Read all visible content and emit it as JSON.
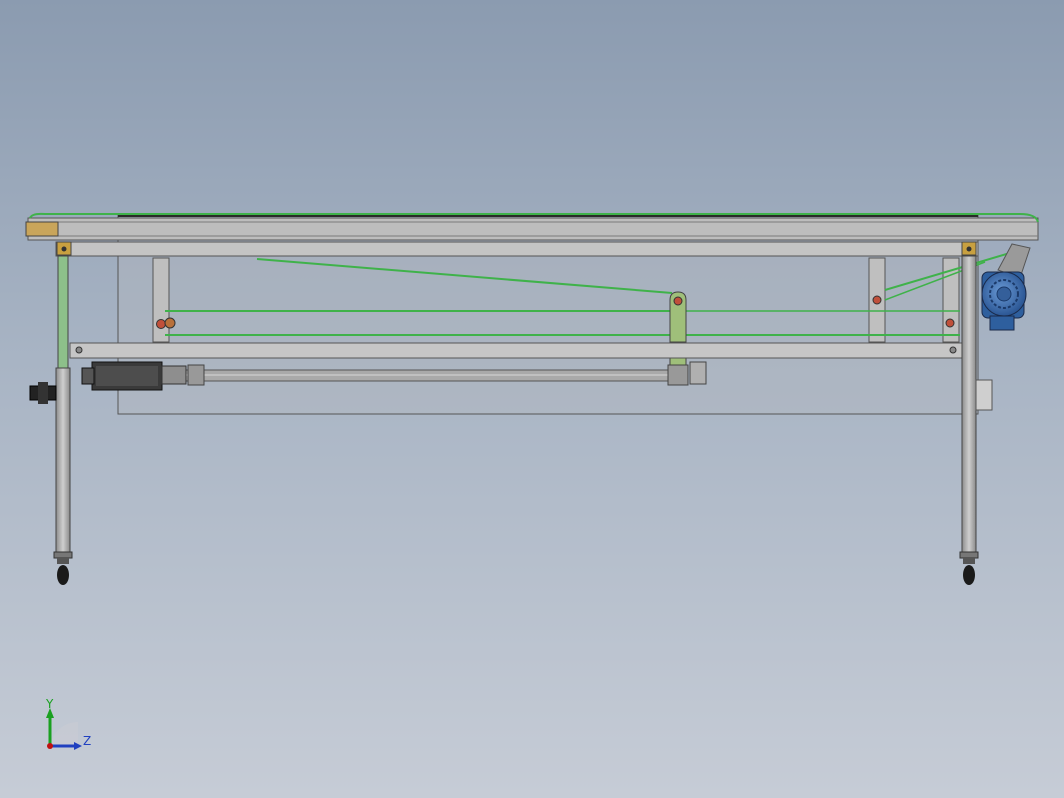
{
  "viewport": {
    "background_top": "#8b9bb0",
    "background_bottom": "#c6ccd6"
  },
  "colors": {
    "frame_gray": "#b9b9b9",
    "frame_edge": "#5a5a5a",
    "belt_green": "#3fb24a",
    "plate_green": "#9fbf7a",
    "bearing_gold": "#c8a040",
    "pin_red": "#c0503a",
    "motor_blue": "#3a6fb5",
    "dark_metal": "#3a3a3a"
  },
  "model": {
    "icons": {
      "conveyor": "conveyor-table-icon",
      "motor": "gear-motor-icon",
      "actuator": "linear-actuator-icon",
      "caster": "caster-wheel-icon"
    }
  },
  "triad": {
    "y_label": "Y",
    "z_label": "Z",
    "y_color": "#1aa020",
    "z_color": "#2040c0",
    "origin_color": "#c01010"
  }
}
